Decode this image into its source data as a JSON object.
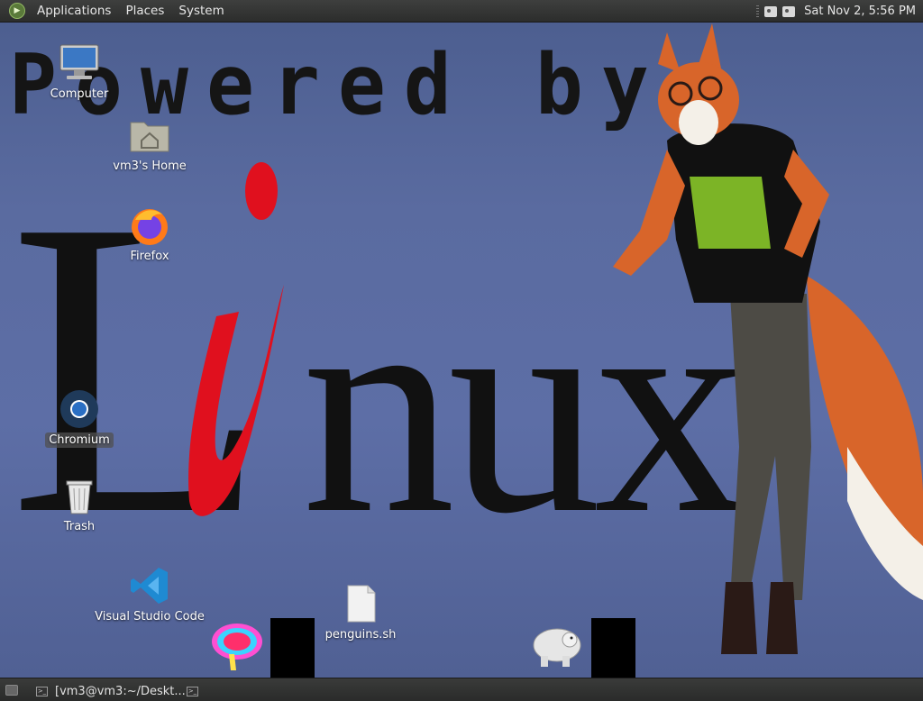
{
  "top_panel": {
    "menus": [
      "Applications",
      "Places",
      "System"
    ],
    "clock": "Sat Nov  2,  5:56 PM"
  },
  "wallpaper": {
    "powered_by": "Powered by",
    "linux": "Linux"
  },
  "desktop_icons": {
    "computer": "Computer",
    "home": "vm3's Home",
    "firefox": "Firefox",
    "chromium": "Chromium",
    "trash": "Trash",
    "vscode": "Visual Studio Code",
    "penguins": "penguins.sh"
  },
  "taskbar": {
    "terminal_task": "[vm3@vm3:~/Deskt..."
  },
  "colors": {
    "panel": "#2c2d2c",
    "wallpaper_blue": "#5a6ba0",
    "linux_red": "#e0101e"
  }
}
